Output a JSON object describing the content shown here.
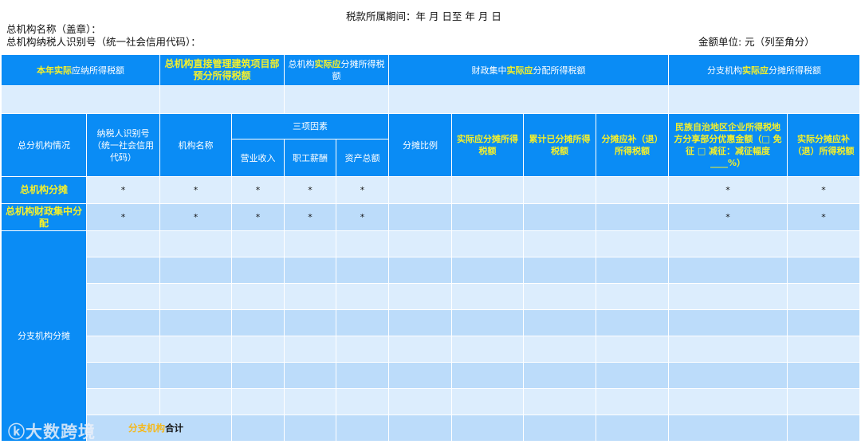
{
  "header": {
    "period": "税款所属期间：年 月 日至 年 月 日",
    "org_name": "总机构名称（盖章）：",
    "tax_id": "总机构纳税人识别号（统一社会信用代码）：",
    "unit": "金额单位: 元（列至角分）"
  },
  "top_headers": [
    {
      "hl": "本年实际",
      "rest": "应纳所得税额"
    },
    {
      "hl": "总机构直接管理建筑项目部预分所得税额",
      "rest": ""
    },
    {
      "pre": "总机构",
      "hl": "实际应",
      "rest": "分摊所得税额"
    },
    {
      "pre": "财政集中",
      "hl": "实际应",
      "rest": "分配所得税额"
    },
    {
      "pre": "分支机构",
      "hl": "实际应",
      "rest": "分摊所得税额"
    }
  ],
  "columns": {
    "situation": "总分机构情况",
    "taxid": "纳税人识别号（统一社会信用代码）",
    "name": "机构名称",
    "factors": "三项因素",
    "revenue": "营业收入",
    "salary": "职工薪酬",
    "assets": "资产总额",
    "ratio": "分摊比例",
    "actual_share": "实际应分摊所得税额",
    "cumulative": "累计已分摊所得税额",
    "supplement": "分摊应补（退）所得税额",
    "ethnic": "民族自治地区企业所得税地方分享部分优惠金额（□ 免征 □ 减征：减征幅度____%）",
    "actual_supp": "实际分摊应补（退）所得税额"
  },
  "rows": {
    "hq_share": "总机构分摊",
    "hq_fiscal": "总机构财政集中分配",
    "branch": "分支机构分摊",
    "star": "*",
    "total_hl": "分支机构",
    "total_rest": "合计"
  },
  "watermark": "大数跨境"
}
